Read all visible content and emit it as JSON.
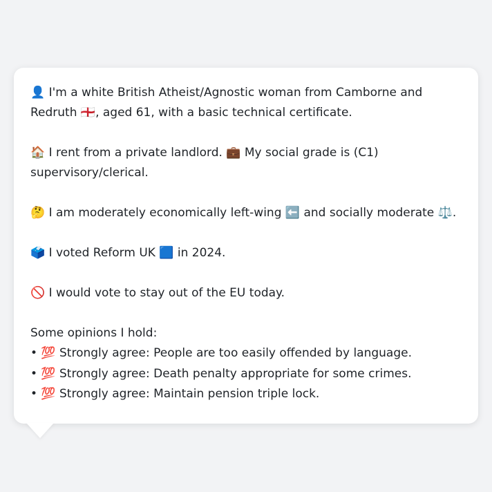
{
  "profile": {
    "identity": "👤 I'm a white British Atheist/Agnostic woman from Camborne and Redruth 🏴󠁧󠁢󠁥󠁮󠁧󠁿, aged 61, with a basic technical certificate.",
    "housing": "🏠 I rent from a private landlord. 💼 My social grade is (C1) supervisory/clerical.",
    "ideology": "🤔 I am moderately economically left-wing ⬅️ and socially moderate ⚖️.",
    "vote2024": "🗳️ I voted Reform UK 🟦 in 2024.",
    "eu": "🚫 I would vote to stay out of the EU today."
  },
  "opinions": {
    "heading": "Some opinions I hold:",
    "items": [
      "• 💯 Strongly agree: People are too easily offended by language.",
      "• 💯 Strongly agree: Death penalty appropriate for some crimes.",
      "• 💯 Strongly agree: Maintain pension triple lock."
    ]
  }
}
